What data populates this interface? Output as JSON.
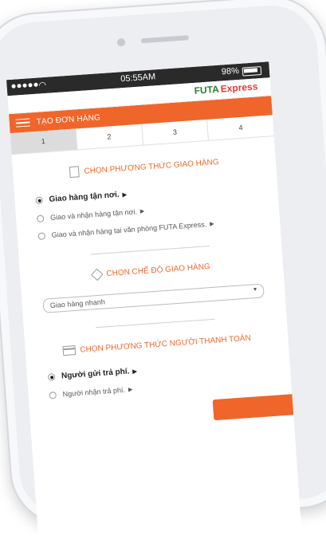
{
  "status": {
    "time": "05:55AM",
    "battery": "98%"
  },
  "brand": {
    "futa": "FUTA",
    "express": "Express"
  },
  "header": {
    "title": "TẠO ĐƠN HÀNG"
  },
  "steps": [
    "1",
    "2",
    "3",
    "4"
  ],
  "sections": {
    "delivery_method": {
      "title": "CHỌN PHƯƠNG THỨC GIAO HÀNG",
      "options": [
        "Giao hàng tận nơi.",
        "Giao và nhận hàng tận nơi.",
        "Giao và nhận hàng tại văn phòng FUTA Express."
      ]
    },
    "delivery_mode": {
      "title": "CHỌN CHẾ ĐỘ GIAO HÀNG",
      "selected": "Giao hàng nhanh"
    },
    "payer": {
      "title": "CHỌN PHƯƠNG THỨC NGƯỜI THANH TOÁN",
      "options": [
        "Người gửi trả phí.",
        "Người nhận trả phí."
      ]
    }
  },
  "colors": {
    "accent": "#f0662a",
    "brand_green": "#2e7d32",
    "brand_red": "#e53935"
  }
}
